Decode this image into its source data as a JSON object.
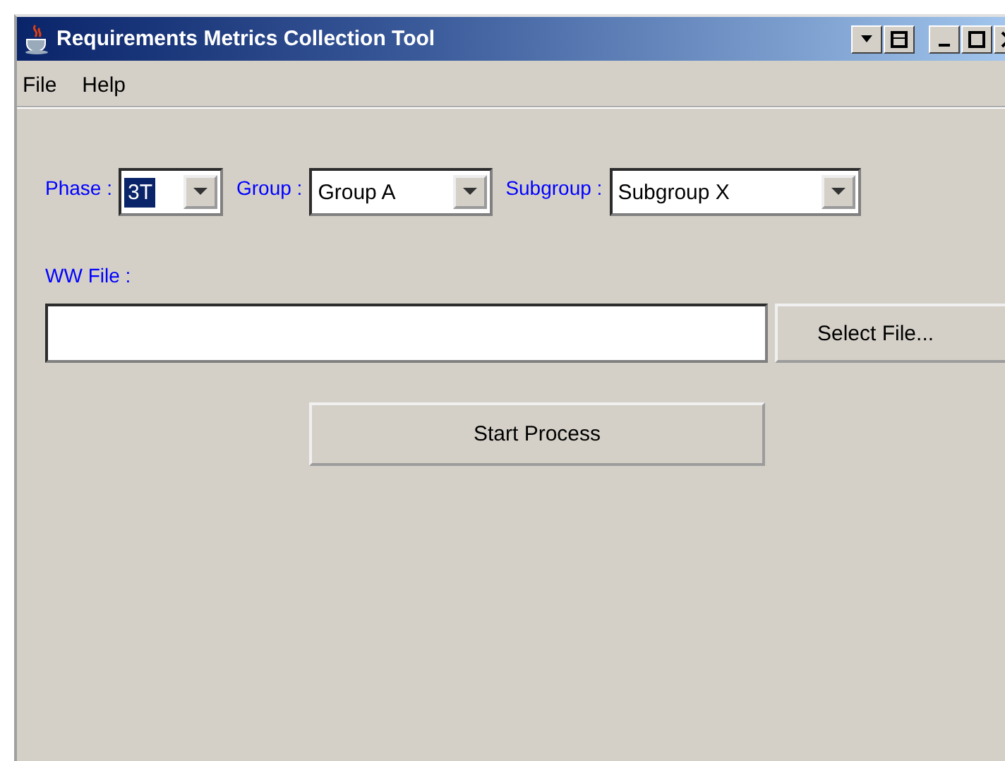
{
  "window": {
    "title": "Requirements Metrics Collection Tool"
  },
  "menu": [
    "File",
    "Help"
  ],
  "selectors": [
    {
      "label": "Phase :",
      "value": "3T",
      "focused": true
    },
    {
      "label": "Group :",
      "value": "Group A",
      "focused": false
    },
    {
      "label": "Subgroup :",
      "value": "Subgroup X",
      "focused": false
    }
  ],
  "file": {
    "label": "WW File :",
    "button": "Select File..."
  },
  "action_button": "Start Process"
}
